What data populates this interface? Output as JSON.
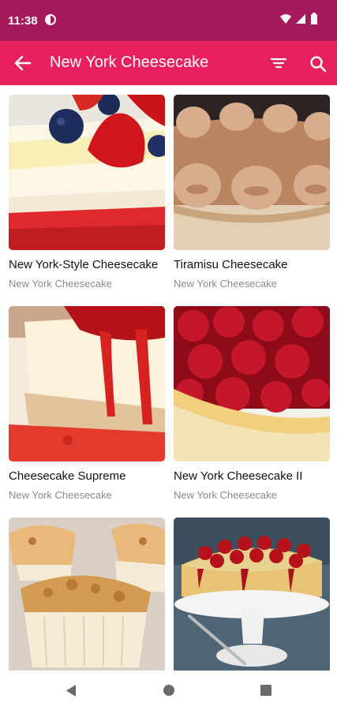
{
  "status_bar": {
    "time": "11:38",
    "icons": [
      "app-notification-icon",
      "wifi-icon",
      "signal-icon",
      "battery-icon"
    ]
  },
  "app_bar": {
    "title": "New York Cheesecake",
    "icons": [
      "back-arrow-icon",
      "filter-icon",
      "search-icon"
    ]
  },
  "recipes": [
    {
      "title": "New York-Style Cheesecake",
      "category": "New York Cheesecake"
    },
    {
      "title": "Tiramisu Cheesecake",
      "category": "New York Cheesecake"
    },
    {
      "title": "Cheesecake Supreme",
      "category": "New York Cheesecake"
    },
    {
      "title": "New York Cheesecake II",
      "category": "New York Cheesecake"
    },
    {
      "title": "",
      "category": ""
    },
    {
      "title": "",
      "category": ""
    }
  ],
  "navigation_bar": {
    "icons": [
      "nav-back-icon",
      "nav-home-icon",
      "nav-recents-icon"
    ]
  },
  "colors": {
    "status_bar": "#a6195b",
    "app_bar": "#e8215e",
    "subtitle_text": "#8a8a8a"
  }
}
